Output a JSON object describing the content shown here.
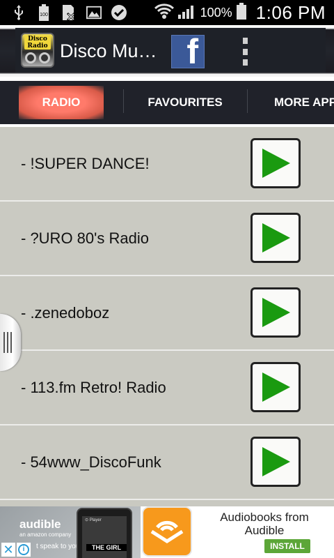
{
  "status_bar": {
    "battery_pct": "100%",
    "time": "1:06 PM",
    "notification_icons": [
      "usb-icon",
      "battery-100-icon",
      "no-sim-icon",
      "image-icon",
      "check-icon"
    ],
    "battery_badge": "100"
  },
  "action_bar": {
    "app_icon_text": "Disco Radio",
    "title": "Disco Mu…",
    "facebook_label": "f"
  },
  "tabs": [
    {
      "label": "RADIO",
      "active": true
    },
    {
      "label": "FAVOURITES",
      "active": false
    },
    {
      "label": "MORE APP",
      "active": false
    }
  ],
  "stations": [
    {
      "label": "- !SUPER DANCE!"
    },
    {
      "label": "- ?URO 80's Radio"
    },
    {
      "label": "- .zenedoboz"
    },
    {
      "label": "- 113.fm Retro! Radio"
    },
    {
      "label": "- 54www_DiscoFunk"
    }
  ],
  "ad": {
    "brand": "audible",
    "brand_sub": "an amazon company",
    "tagline": "t speak to you",
    "phone_header": "⊙ Player",
    "phone_book": "THE GIRL",
    "headline": "Audiobooks from Audible",
    "install": "INSTALL"
  },
  "colors": {
    "accent_tab": "#f07a68",
    "play_green": "#1a9a10",
    "facebook": "#3b5998",
    "list_bg": "#cacac2",
    "install": "#5ca638"
  }
}
